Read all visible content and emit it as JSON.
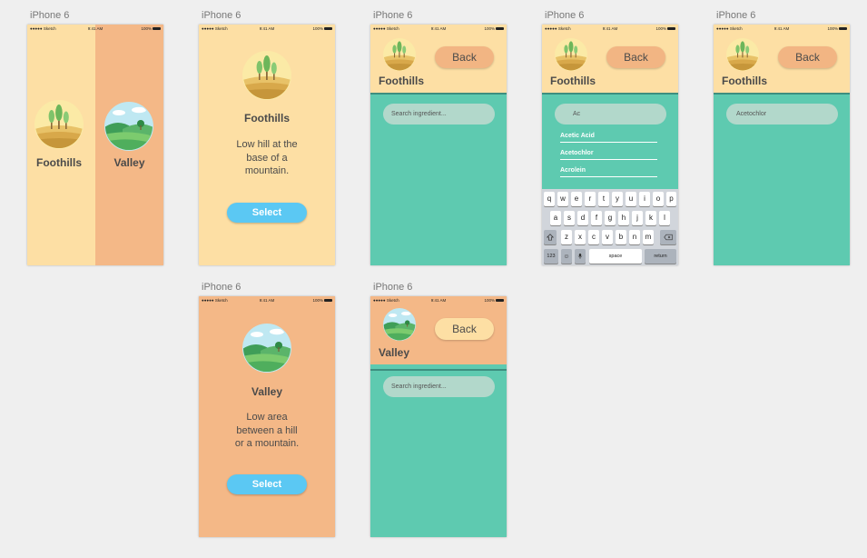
{
  "device_label": "iPhone 6",
  "status_bar": {
    "carrier": "●●●●● Sketch",
    "time": "9:41 AM",
    "battery": "100%"
  },
  "screen1": {
    "left_label": "Foothills",
    "right_label": "Valley"
  },
  "foothills_detail": {
    "title": "Foothills",
    "description_lines": [
      "Low hill at the",
      "base of a",
      "mountain."
    ],
    "select_label": "Select"
  },
  "valley_detail": {
    "title": "Valley",
    "description_lines": [
      "Low area",
      "between a hill",
      "or a mountain."
    ],
    "select_label": "Select"
  },
  "search_foothills": {
    "header_title": "Foothills",
    "back_label": "Back",
    "search_placeholder": "Search ingredient..."
  },
  "search_typing": {
    "header_title": "Foothills",
    "back_label": "Back",
    "search_value": "Ac",
    "suggestions": [
      "Acetic Acid",
      "Acetochlor",
      "Acrolein"
    ]
  },
  "search_selected": {
    "header_title": "Foothills",
    "back_label": "Back",
    "search_value": "Acetochlor"
  },
  "search_valley": {
    "header_title": "Valley",
    "back_label": "Back",
    "search_placeholder": "Search ingredient..."
  },
  "keyboard": {
    "row1": [
      "q",
      "w",
      "e",
      "r",
      "t",
      "y",
      "u",
      "i",
      "o",
      "p"
    ],
    "row2": [
      "a",
      "s",
      "d",
      "f",
      "g",
      "h",
      "j",
      "k",
      "l"
    ],
    "row3": [
      "z",
      "x",
      "c",
      "v",
      "b",
      "n",
      "m"
    ],
    "numbers_key": "123",
    "space_key": "space",
    "return_key": "return"
  },
  "colors": {
    "yellow": "#fddfa4",
    "orange": "#f4b887",
    "teal": "#5ecab0",
    "select_blue": "#5bc8f3",
    "back_orange": "#f2b583"
  }
}
